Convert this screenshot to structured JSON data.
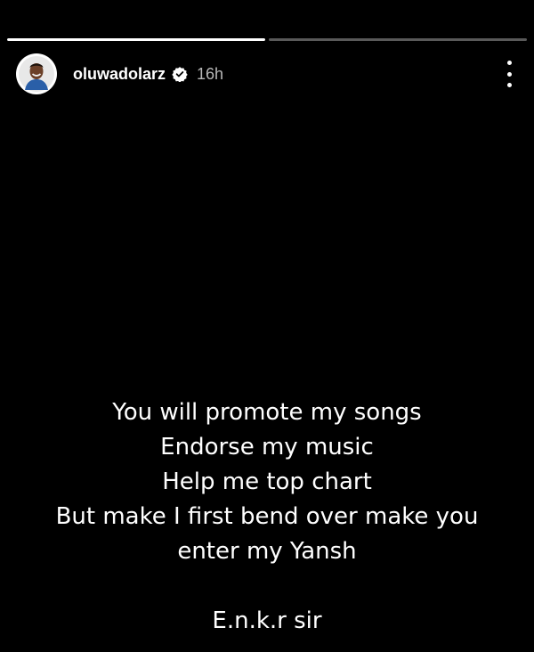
{
  "story": {
    "progress": [
      1,
      0
    ],
    "header": {
      "username": "oluwadolarz",
      "verified": true,
      "time": "16h"
    },
    "caption": {
      "lines": [
        "You will promote my songs",
        "Endorse my music",
        "Help me top chart",
        "But make I first bend over make you",
        "enter my Yansh"
      ],
      "signoff": "E.n.k.r sir"
    },
    "icons": {
      "verified": "verified-badge-icon",
      "more": "more-options-icon"
    },
    "colors": {
      "background": "#000000",
      "text": "#ffffff",
      "muted": "#b8b8b8"
    }
  }
}
